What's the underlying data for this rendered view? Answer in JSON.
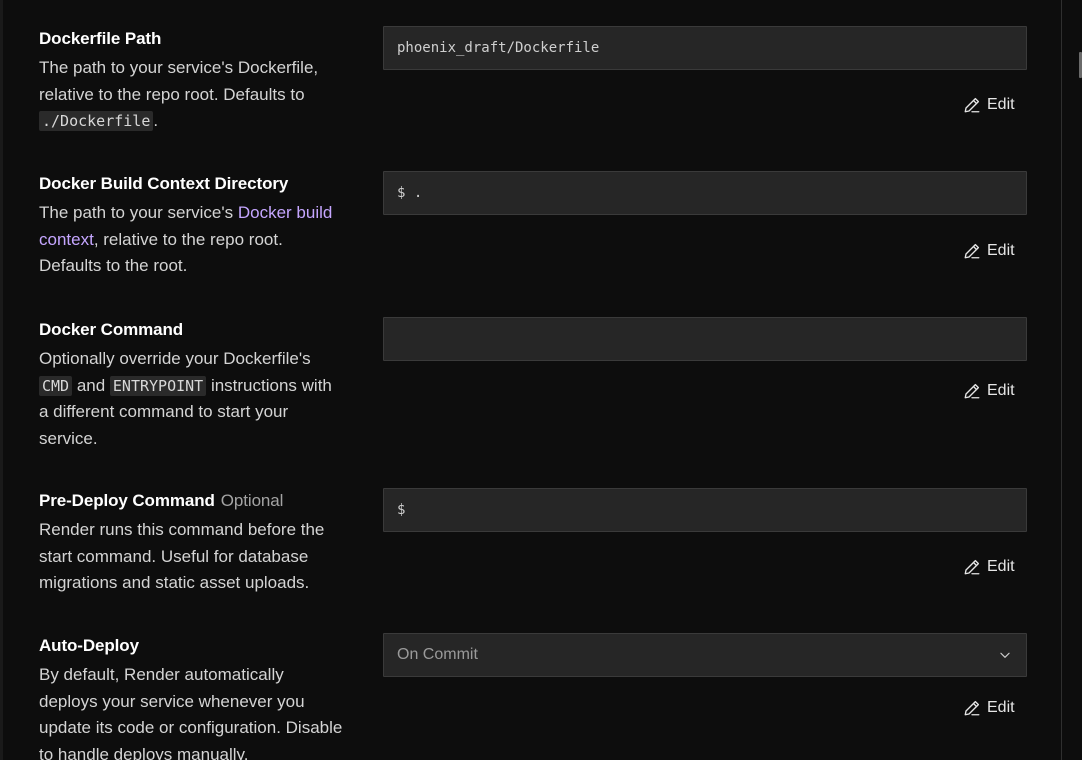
{
  "sections": [
    {
      "title": "Dockerfile Path",
      "desc_1": "The path to your service's Dockerfile, relative to the repo root. Defaults to ",
      "desc_code": "./Dockerfile",
      "desc_2": ".",
      "value": "phoenix_draft/Dockerfile",
      "edit_label": "Edit"
    },
    {
      "title": "Docker Build Context Directory",
      "desc_1": "The path to your service's ",
      "desc_link": "Docker build context",
      "desc_2": ", relative to the repo root. Defaults to the root.",
      "value": "$ .",
      "edit_label": "Edit"
    },
    {
      "title": "Docker Command",
      "desc_1": "Optionally override your Dockerfile's ",
      "desc_code_1": "CMD",
      "desc_2": " and ",
      "desc_code_2": "ENTRYPOINT",
      "desc_3": " instructions with a different command to start your service.",
      "value": "",
      "edit_label": "Edit"
    },
    {
      "title": "Pre-Deploy Command",
      "optional": "Optional",
      "desc": "Render runs this command before the start command. Useful for database migrations and static asset uploads.",
      "value": "$",
      "edit_label": "Edit"
    },
    {
      "title": "Auto-Deploy",
      "desc": "By default, Render automatically deploys your service whenever you update its code or configuration. Disable to handle deploys manually.",
      "selected": "On Commit",
      "edit_label": "Edit"
    }
  ],
  "icons": {
    "edit": "pencil-icon",
    "select": "chevron-down-icon"
  },
  "colors": {
    "background": "#0d0d0d",
    "field": "#262626",
    "link": "#c5a6ff",
    "title": "#ffffff"
  }
}
